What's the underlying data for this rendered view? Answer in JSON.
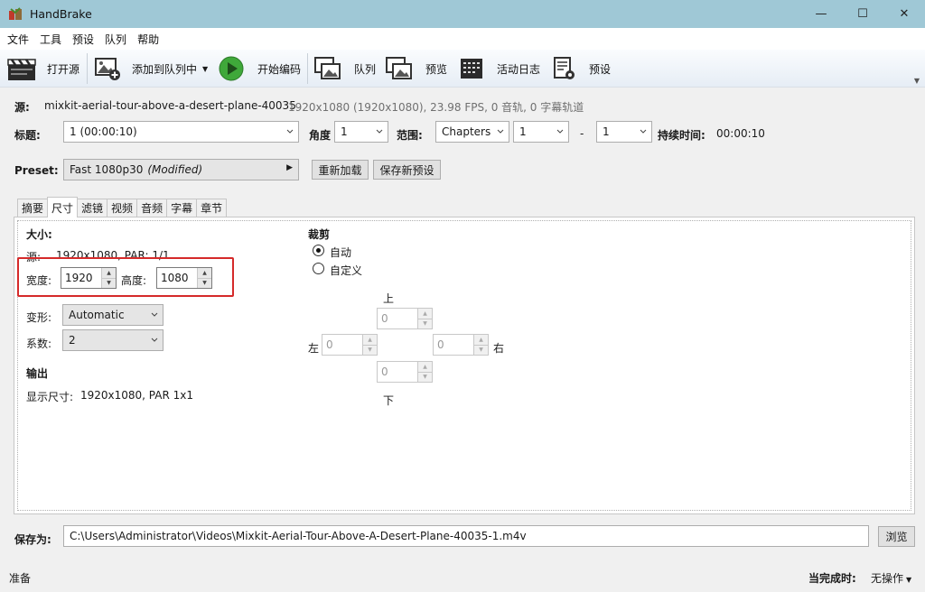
{
  "window": {
    "title": "HandBrake",
    "minimize": "—",
    "maximize": "☐",
    "close": "✕"
  },
  "menu": [
    "文件",
    "工具",
    "预设",
    "队列",
    "帮助"
  ],
  "toolbar": {
    "open_source": "打开源",
    "add_to_queue": "添加到队列中",
    "start_encode": "开始编码",
    "queue": "队列",
    "preview": "预览",
    "activity_log": "活动日志",
    "presets": "预设"
  },
  "source": {
    "label": "源:",
    "name": "mixkit-aerial-tour-above-a-desert-plane-40035",
    "info": "1920x1080 (1920x1080), 23.98 FPS, 0 音轨, 0 字幕轨道"
  },
  "title_row": {
    "title_label": "标题:",
    "title_value": "1  (00:00:10)",
    "angle_label": "角度",
    "angle_value": "1",
    "range_label": "范围:",
    "range_mode": "Chapters",
    "range_start": "1",
    "range_sep": "-",
    "range_end": "1",
    "duration_label": "持续时间:",
    "duration_value": "00:00:10"
  },
  "preset": {
    "label": "Preset:",
    "name": "Fast 1080p30",
    "modified": "(Modified)",
    "reload_button": "重新加载",
    "save_button": "保存新预设"
  },
  "tabs": [
    "摘要",
    "尺寸",
    "滤镜",
    "视频",
    "音频",
    "字幕",
    "章节"
  ],
  "active_tab": 1,
  "dimensions": {
    "size_header": "大小:",
    "source_label": "源:",
    "source_value": "1920x1080, PAR: 1/1",
    "width_label": "宽度:",
    "width_value": "1920",
    "height_label": "高度:",
    "height_value": "1080",
    "anamorphic_label": "变形:",
    "anamorphic_value": "Automatic",
    "modulus_label": "系数:",
    "modulus_value": "2",
    "output_header": "输出",
    "display_label": "显示尺寸:",
    "display_value": "1920x1080,  PAR 1x1"
  },
  "cropping": {
    "header": "裁剪",
    "auto_label": "自动",
    "custom_label": "自定义",
    "top_label": "上",
    "bottom_label": "下",
    "left_label": "左",
    "right_label": "右",
    "top": "0",
    "bottom": "0",
    "left": "0",
    "right": "0"
  },
  "save_as": {
    "label": "保存为:",
    "path": "C:\\Users\\Administrator\\Videos\\Mixkit-Aerial-Tour-Above-A-Desert-Plane-40035-1.m4v",
    "browse_button": "浏览"
  },
  "status": {
    "text": "准备",
    "when_done_label": "当完成时:",
    "when_done_value": "无操作"
  },
  "colors": {
    "titlebar": "#9fc8d6",
    "highlight": "#d52a2a",
    "play_green": "#3fa83a"
  }
}
